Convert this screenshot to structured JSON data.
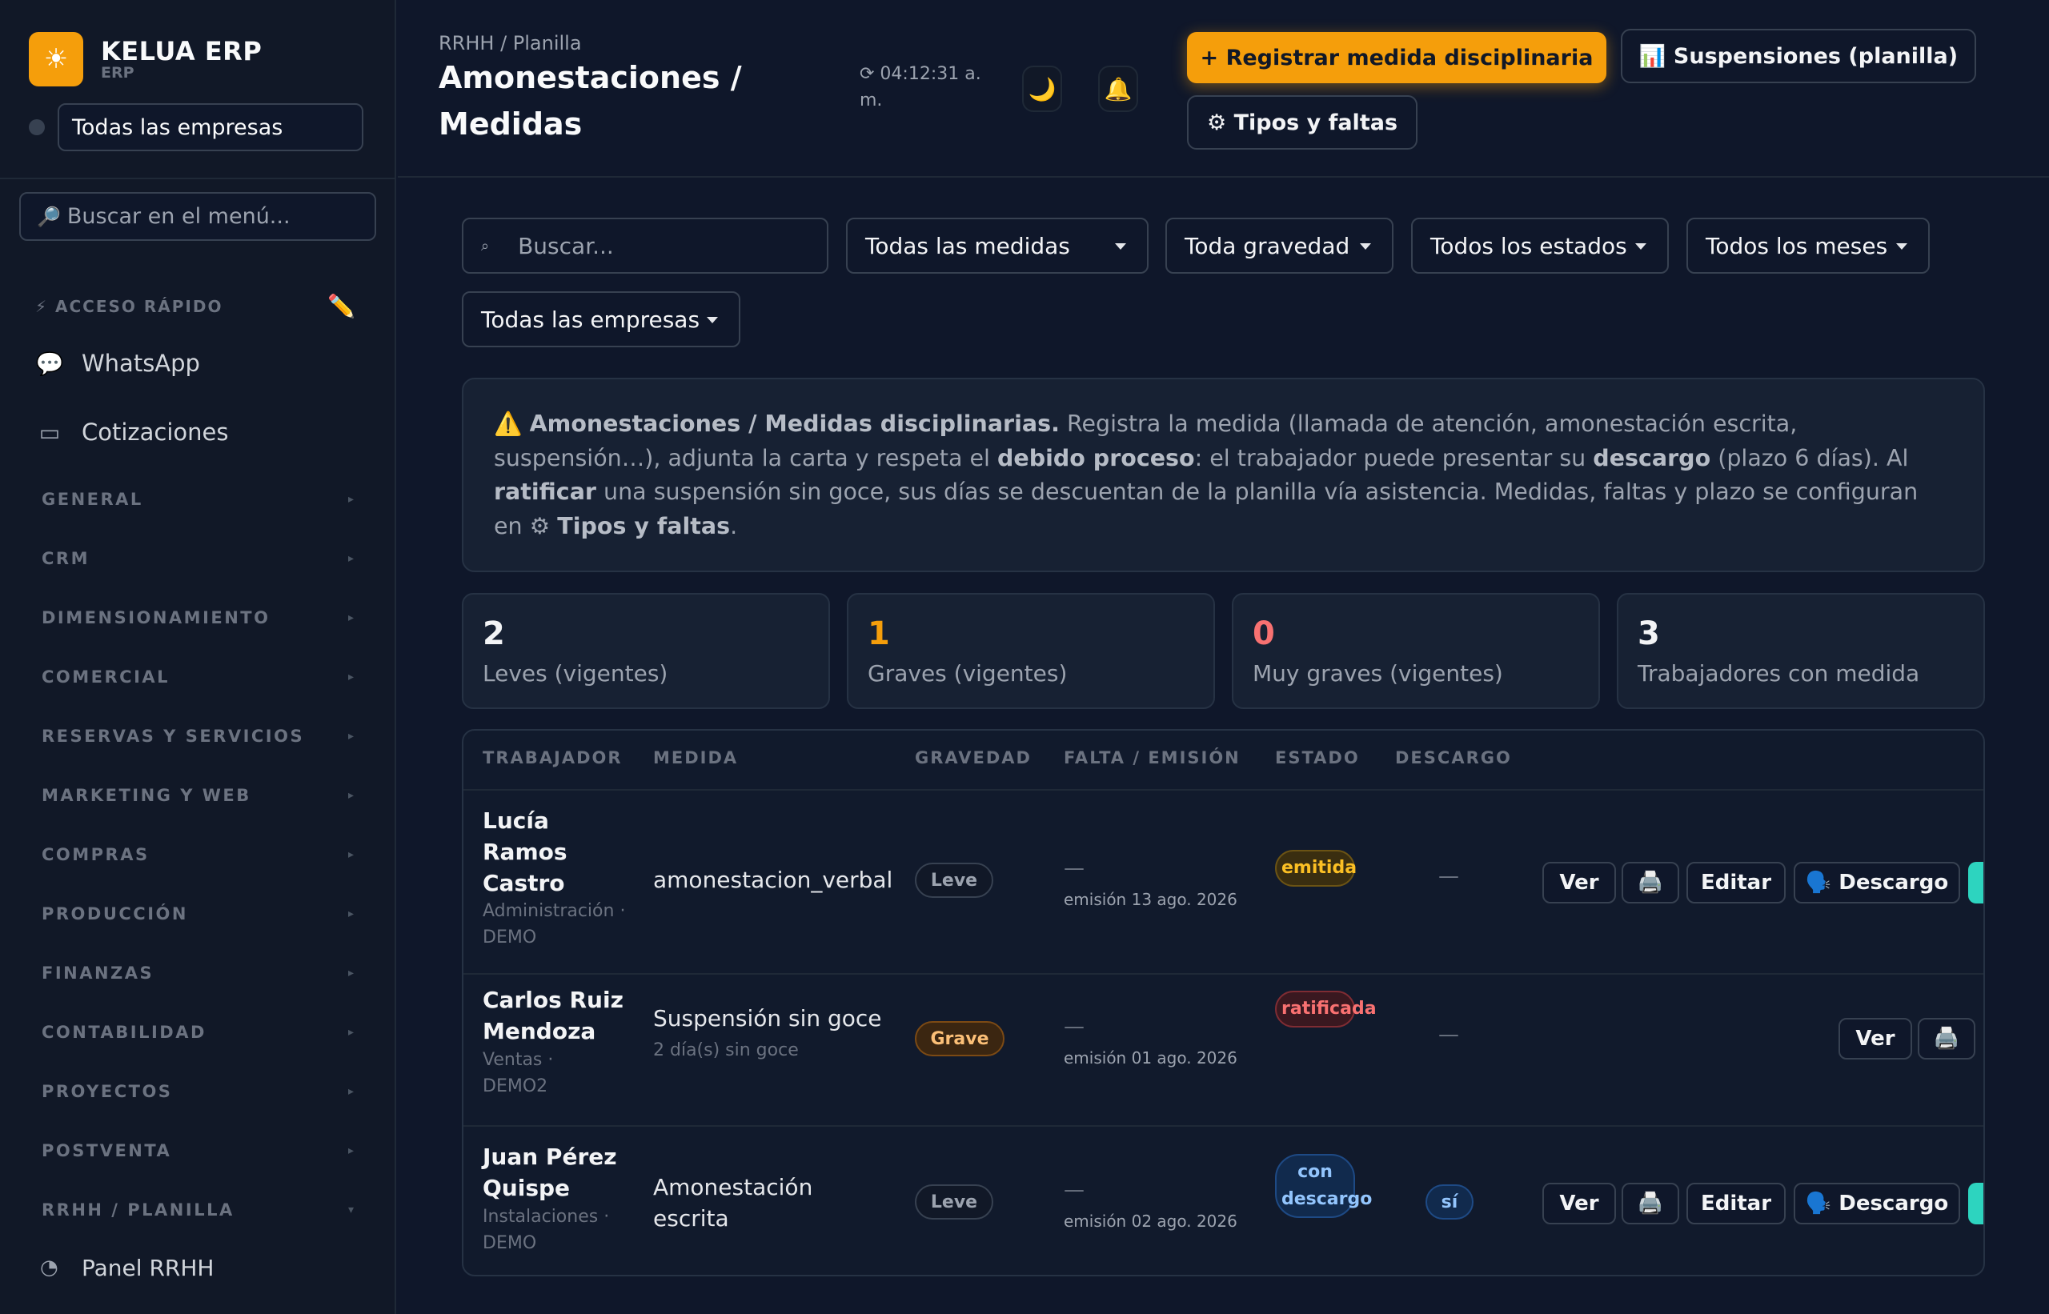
{
  "sidebar": {
    "brand_icon": "sun-icon",
    "brand_name": "KELUA ERP",
    "brand_sub": "ERP",
    "company_select": "Todas las empresas",
    "menu_search_placeholder": "Buscar en el menú...",
    "quick_access_label": "⚡ ACCESO RÁPIDO",
    "quick_items": [
      {
        "label": "WhatsApp",
        "icon": "chat-icon"
      },
      {
        "label": "Cotizaciones",
        "icon": "document-icon"
      }
    ],
    "sections": [
      "GENERAL",
      "CRM",
      "DIMENSIONAMIENTO",
      "COMERCIAL",
      "RESERVAS Y SERVICIOS",
      "MARKETING Y WEB",
      "COMPRAS",
      "PRODUCCIÓN",
      "FINANZAS",
      "CONTABILIDAD",
      "PROYECTOS",
      "POSTVENTA",
      "RRHH / PLANILLA"
    ],
    "sub_item": "Panel RRHH"
  },
  "header": {
    "breadcrumb": "RRHH / Planilla",
    "title": "Amonestaciones / Medidas",
    "clock": "⟳ 04:12:31 a. m.",
    "primary_button": "+ Registrar medida disciplinaria",
    "suspensions_button": "📊 Suspensiones (planilla)",
    "types_button": "⚙ Tipos y faltas"
  },
  "filters": {
    "search_placeholder": "Buscar...",
    "medidas": "Todas las medidas",
    "gravedad": "Toda gravedad",
    "estados": "Todos los estados",
    "meses": "Todos los meses",
    "empresas": "Todas las empresas"
  },
  "info": {
    "icon": "⚠️",
    "title": "Amonestaciones / Medidas disciplinarias.",
    "t1": " Registra la medida (llamada de atención, amonestación escrita, suspensión…), adjunta la carta y respeta el ",
    "b1": "debido proceso",
    "t2": ": el trabajador puede presentar su ",
    "b2": "descargo",
    "t3": " (plazo 6 días). Al ",
    "b3": "ratificar",
    "t4": " una suspensión sin goce, sus días se descuentan de la planilla vía asistencia. Medidas, faltas y plazo se configuran en ⚙ ",
    "b4": "Tipos y faltas",
    "t5": "."
  },
  "stats": [
    {
      "value": "2",
      "label": "Leves (vigentes)",
      "color": "#f3f4f6"
    },
    {
      "value": "1",
      "label": "Graves (vigentes)",
      "color": "#f59e0b"
    },
    {
      "value": "0",
      "label": "Muy graves (vigentes)",
      "color": "#f87171"
    },
    {
      "value": "3",
      "label": "Trabajadores con medida",
      "color": "#f3f4f6"
    }
  ],
  "table": {
    "headers": [
      "TRABAJADOR",
      "MEDIDA",
      "GRAVEDAD",
      "FALTA / EMISIÓN",
      "ESTADO",
      "DESCARGO"
    ],
    "rows": [
      {
        "name": "Lucía Ramos Castro",
        "dept": "Administración · DEMO",
        "medida": "amonestacion_verbal",
        "medida_sub": "",
        "gravedad": "Leve",
        "falta": "—",
        "emision": "emisión 13 ago. 2026",
        "estado": "emitida",
        "descargo": "—",
        "actions": {
          "ver": "Ver",
          "print": "🖨️",
          "editar": "Editar",
          "descargo": "🗣️ Descargo"
        }
      },
      {
        "name": "Carlos Ruiz Mendoza",
        "dept": "Ventas · DEMO2",
        "medida": "Suspensión sin goce",
        "medida_sub": "2 día(s) sin goce",
        "gravedad": "Grave",
        "falta": "—",
        "emision": "emisión 01 ago. 2026",
        "estado": "ratificada",
        "descargo": "—",
        "actions": {
          "ver": "Ver",
          "print": "🖨️"
        }
      },
      {
        "name": "Juan Pérez Quispe",
        "dept": "Instalaciones · DEMO",
        "medida": "Amonestación escrita",
        "medida_sub": "",
        "gravedad": "Leve",
        "falta": "—",
        "emision": "emisión 02 ago. 2026",
        "estado": "con descargo",
        "descargo": "sí",
        "actions": {
          "ver": "Ver",
          "print": "🖨️",
          "editar": "Editar",
          "descargo": "🗣️ Descargo"
        }
      }
    ]
  },
  "colors": {
    "accent": "#f59e0b",
    "background": "#0f172a",
    "sidebar": "#111827"
  }
}
